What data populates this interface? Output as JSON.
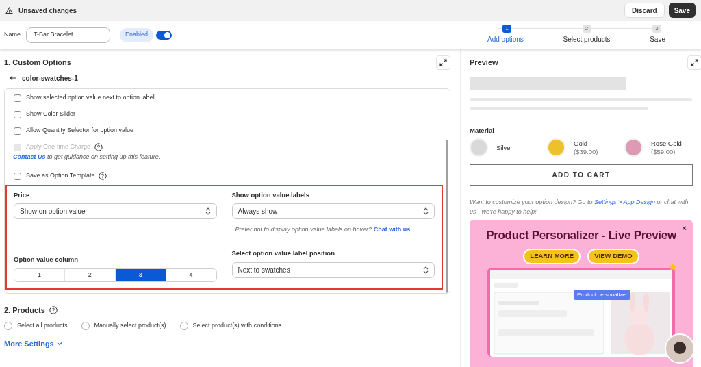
{
  "header": {
    "title": "Unsaved changes",
    "buttons": [
      {
        "label": "Discard",
        "kind": "secondary"
      },
      {
        "label": "Save",
        "kind": "primary"
      }
    ]
  },
  "name_bar": {
    "label": "Name",
    "value": "T-Bar Bracelet",
    "status": "Enabled",
    "on": true
  },
  "steps": [
    {
      "number": "1",
      "label": "Add options",
      "selected": true
    },
    {
      "number": "2",
      "label": "Select products",
      "selected": false
    },
    {
      "number": "3",
      "label": "Save",
      "selected": false
    }
  ],
  "custom_options": {
    "title": "1. Custom Options",
    "option_name": "color-swatches-1",
    "settings": [
      {
        "kind": "checkbox",
        "label": "Show selected option value next to option label",
        "checked": false,
        "disabled": false,
        "help": false
      },
      {
        "kind": "checkbox",
        "label": "Show Color Slider",
        "checked": false,
        "disabled": false,
        "help": false
      },
      {
        "kind": "checkbox",
        "label": "Allow Quantity Selector for option value",
        "checked": false,
        "disabled": false,
        "help": false
      },
      {
        "kind": "checkbox",
        "label": "Apply One-time Charge",
        "checked": false,
        "disabled": true,
        "help": true
      },
      {
        "kind": "note",
        "link": "Contact Us",
        "label": " to get guidance on setting up this feature."
      },
      {
        "kind": "checkbox",
        "label": "Save as Option Template",
        "checked": false,
        "disabled": false,
        "help": true
      }
    ],
    "price": {
      "label": "Price",
      "value": "Show on option value"
    },
    "labels": {
      "label": "Show option value labels",
      "value": "Always show",
      "hint": "Prefer not to display option value labels on hover?",
      "link": "Chat with us"
    },
    "columns": {
      "label": "Option value column",
      "options": [
        {
          "label": "1",
          "selected": false
        },
        {
          "label": "2",
          "selected": false
        },
        {
          "label": "3",
          "selected": true
        },
        {
          "label": "4",
          "selected": false
        }
      ]
    },
    "position": {
      "label": "Select option value label position",
      "value": "Next to swatches"
    }
  },
  "products": {
    "title": "2. Products",
    "options": [
      {
        "label": "Select all products",
        "selected": false
      },
      {
        "label": "Manually select product(s)",
        "selected": false
      },
      {
        "label": "Select product(s) with conditions",
        "selected": false
      }
    ]
  },
  "more_settings": "More Settings",
  "preview": {
    "title": "Preview",
    "attribute": "Material",
    "swatches": [
      {
        "name": "Silver",
        "color": "#d9d9d9"
      },
      {
        "name": "Gold",
        "price": "($39.00)",
        "color": "#ecc12a"
      },
      {
        "name": "Rose Gold",
        "price": "($59.00)",
        "color": "#df9ab3"
      }
    ],
    "button": "ADD TO CART",
    "note": {
      "text": "Want to customize your option design? Go to ",
      "link": "Settings > App Design",
      "rest": " or chat with us - we're happy to help!"
    },
    "banner": {
      "close": "×",
      "title": "Product Personalizer - Live Preview",
      "buttons": [
        "LEARN MORE",
        "VIEW DEMO"
      ],
      "tag": "Product personalizer"
    }
  }
}
